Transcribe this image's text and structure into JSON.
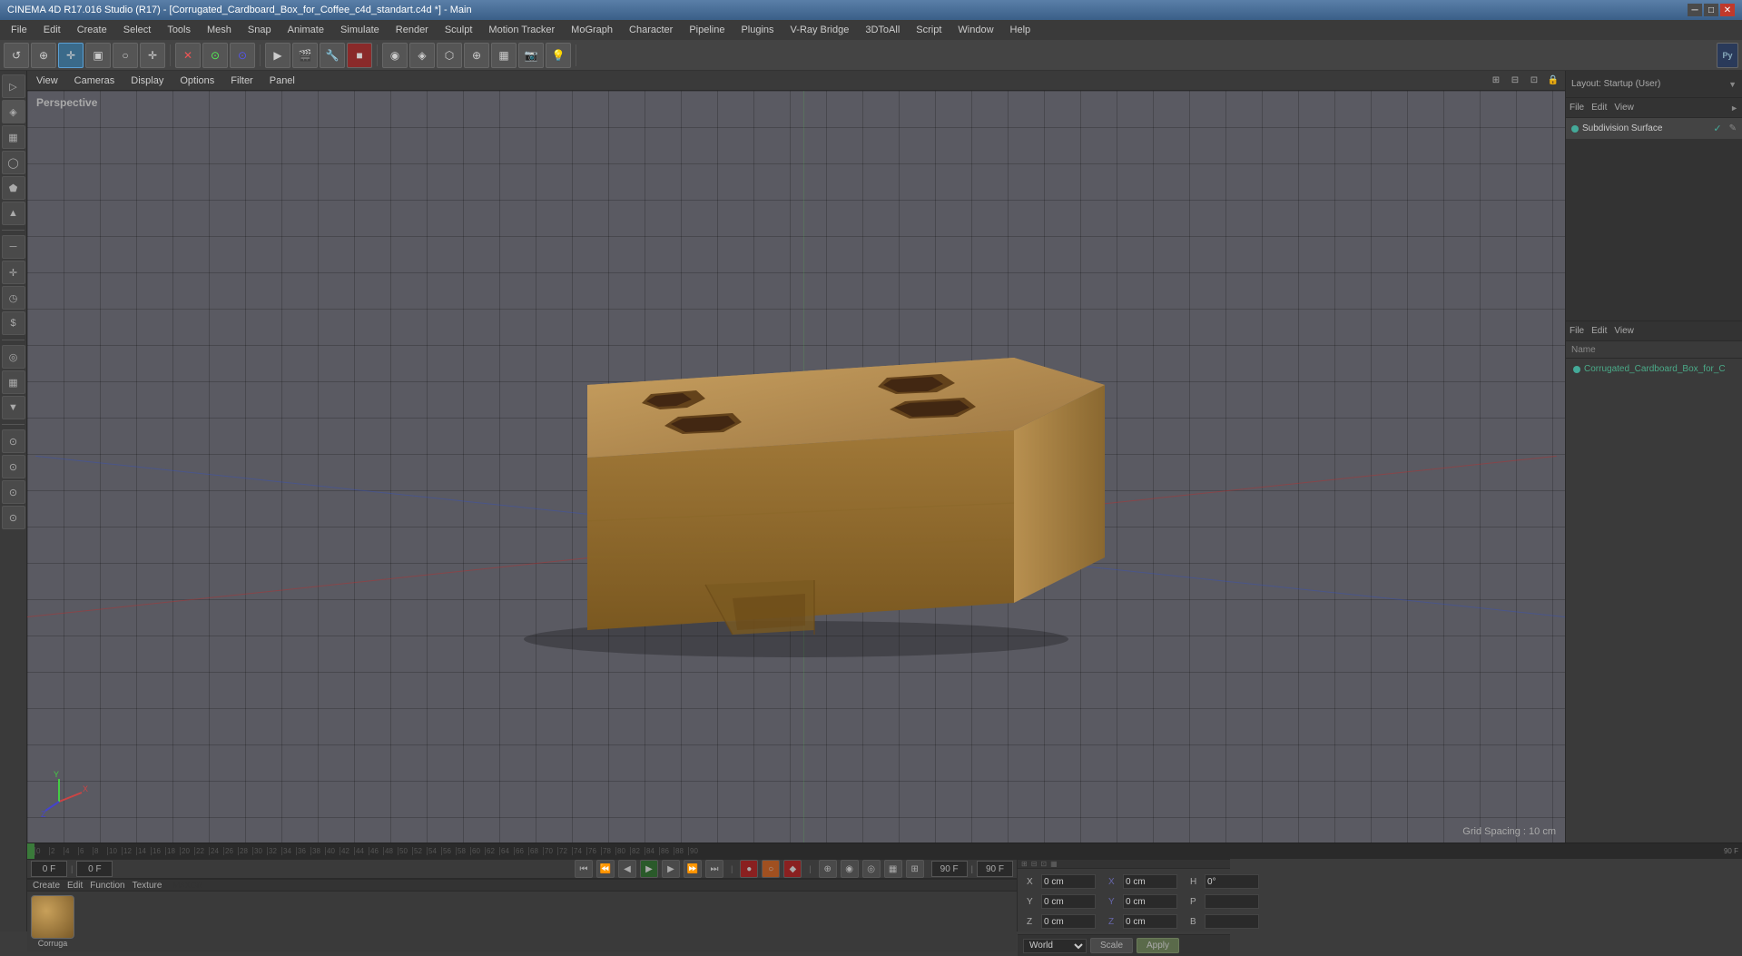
{
  "title_bar": {
    "title": "CINEMA 4D R17.016 Studio (R17) - [Corrugated_Cardboard_Box_for_Coffee_c4d_standart.c4d *] - Main",
    "min_label": "─",
    "max_label": "□",
    "close_label": "✕"
  },
  "menu_bar": {
    "items": [
      "File",
      "Edit",
      "Create",
      "Select",
      "Tools",
      "Mesh",
      "Snap",
      "Animate",
      "Simulate",
      "Render",
      "Sculpt",
      "Motion Tracker",
      "MoGraph",
      "Character",
      "Pipeline",
      "Plugins",
      "V-Ray Bridge",
      "3DToAll",
      "Script",
      "Window",
      "Help"
    ]
  },
  "toolbar": {
    "buttons": [
      "↺",
      "⊙",
      "✛",
      "▣",
      "○",
      "✛",
      "✕",
      "⊙",
      "⊙",
      "▶",
      "✕",
      "◎",
      "⊙",
      "⌂",
      "⚑",
      "⊙",
      "⊙",
      "⊙",
      "⊙",
      "⊙",
      "⊙",
      "⊙"
    ]
  },
  "viewport": {
    "label": "Perspective",
    "grid_spacing": "Grid Spacing : 10 cm",
    "menus": [
      "View",
      "Cameras",
      "Display",
      "Options",
      "Filter",
      "Panel"
    ],
    "axis_labels": {
      "x": "X",
      "y": "Y",
      "z": "Z"
    }
  },
  "left_tools": {
    "buttons": [
      "▷",
      "◈",
      "▦",
      "◯",
      "⬟",
      "▲",
      "─",
      "◷",
      "$",
      "◎",
      "▦",
      "▼",
      "⊙",
      "⊙",
      "⊙"
    ]
  },
  "right_panel": {
    "layout_label": "Layout: Startup (User)",
    "menu_top": [
      "File",
      "Edit",
      "View",
      "►"
    ],
    "menu2": [
      "File",
      "Edit",
      "View"
    ],
    "subdivision_label": "Subdivision Surface",
    "name_label": "Name",
    "scene_items": [
      {
        "label": "Corrugated_Cardboard_Box_for_C",
        "color": "#44aa88"
      }
    ]
  },
  "timeline": {
    "markers": [
      "0",
      "2",
      "4",
      "6",
      "8",
      "10",
      "12",
      "14",
      "16",
      "18",
      "20",
      "22",
      "24",
      "26",
      "28",
      "30",
      "32",
      "34",
      "36",
      "38",
      "40",
      "42",
      "44",
      "46",
      "48",
      "50",
      "52",
      "54",
      "56",
      "58",
      "60",
      "62",
      "64",
      "66",
      "68",
      "70",
      "72",
      "74",
      "76",
      "78",
      "80",
      "82",
      "84",
      "86",
      "88",
      "90",
      "90"
    ]
  },
  "frame_controls": {
    "start_frame": "0 F",
    "current_frame": "0 F",
    "end_frame": "90 F",
    "fps": "90 F",
    "playback_buttons": [
      "⏮",
      "⟳",
      "⏪",
      "▶",
      "⏩",
      "⏭",
      "⏸"
    ]
  },
  "material_editor": {
    "menus": [
      "Create",
      "Edit",
      "Function",
      "Texture"
    ],
    "material_name": "Corruga"
  },
  "coord_panel": {
    "labels": {
      "x_pos": "X",
      "y_pos": "Y",
      "z_pos": "Z",
      "x_size": "X",
      "y_size": "Y",
      "z_size": "Z",
      "h": "H",
      "p": "P",
      "b": "B"
    },
    "values": {
      "x_pos": "0 cm",
      "y_pos": "0 cm",
      "z_pos": "0 cm",
      "x_size": "0 cm",
      "y_size": "0 cm",
      "z_size": "0 cm",
      "h": "0°",
      "p": "",
      "b": ""
    },
    "world_label": "World",
    "scale_label": "Scale",
    "apply_label": "Apply"
  }
}
